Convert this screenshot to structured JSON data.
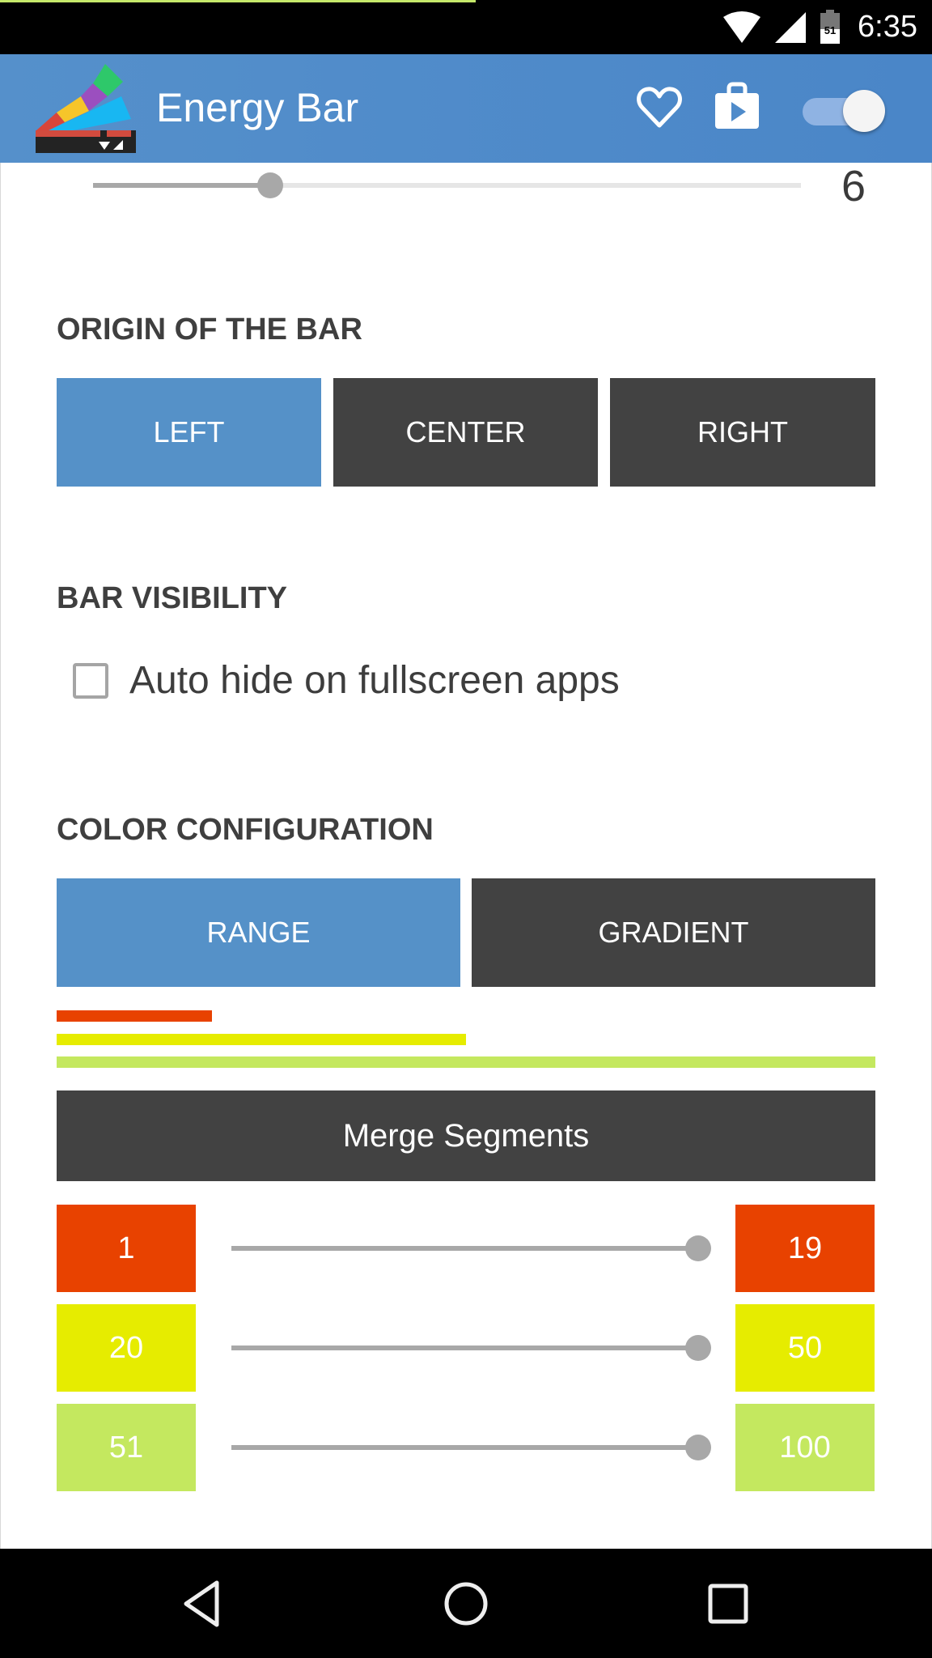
{
  "status_bar": {
    "time": "6:35",
    "battery_level": "51",
    "energy_bar_fraction": 0.51,
    "energy_bar_color": "#c5e86a",
    "icons": [
      "wifi-icon",
      "cell-signal-icon",
      "battery-icon"
    ]
  },
  "app_bar": {
    "title": "Energy Bar",
    "color": "#4f8bca",
    "actions": [
      "heart-icon",
      "play-store-icon"
    ],
    "enabled_toggle": true
  },
  "thickness": {
    "value": "6",
    "slider_fraction": 0.25
  },
  "origin": {
    "title": "ORIGIN OF THE BAR",
    "options": [
      {
        "label": "LEFT",
        "active": true
      },
      {
        "label": "CENTER",
        "active": false
      },
      {
        "label": "RIGHT",
        "active": false
      }
    ]
  },
  "visibility": {
    "title": "BAR VISIBILITY",
    "auto_hide_label": "Auto hide on fullscreen apps",
    "auto_hide_checked": false
  },
  "color_config": {
    "title": "COLOR CONFIGURATION",
    "modes": [
      {
        "label": "RANGE",
        "active": true
      },
      {
        "label": "GRADIENT",
        "active": false
      }
    ],
    "merge_label": "Merge Segments",
    "segments": [
      {
        "from": "1",
        "to": "19",
        "color": "#e84200",
        "slider_fraction": 1.0,
        "preview_fraction": 0.19
      },
      {
        "from": "20",
        "to": "50",
        "color": "#e6ec00",
        "slider_fraction": 1.0,
        "preview_fraction": 0.5
      },
      {
        "from": "51",
        "to": "100",
        "color": "#c4e85f",
        "slider_fraction": 1.0,
        "preview_fraction": 1.0
      }
    ]
  },
  "colors": {
    "active_button": "#5591c8",
    "inactive_button": "#424242",
    "section_title": "#3f3f3f"
  },
  "nav_bar": {
    "buttons": [
      "back-icon",
      "home-icon",
      "recents-icon"
    ]
  }
}
